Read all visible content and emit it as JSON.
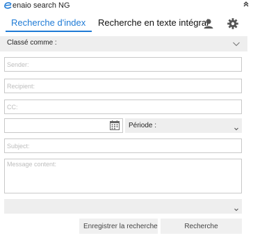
{
  "window": {
    "title": "enaio search NG",
    "logo_icon": "enaio-logo-icon",
    "collapse_icon": "double-chevron-up-icon"
  },
  "tabs": [
    {
      "label": "Recherche d'index",
      "active": true
    },
    {
      "label": "Recherche en texte intégral",
      "active": false
    }
  ],
  "toolbar_icons": [
    "user-icon",
    "gear-icon"
  ],
  "accent_color": "#1f7bd6",
  "classe": {
    "label": "Classé comme :",
    "icon": "chevron-down-icon"
  },
  "fields": {
    "sender": {
      "placeholder": "Sender:",
      "value": ""
    },
    "recipient": {
      "placeholder": "Recipient:",
      "value": ""
    },
    "cc": {
      "placeholder": "CC:",
      "value": ""
    },
    "date": {
      "placeholder": "",
      "value": "",
      "icon": "calendar-icon"
    },
    "subject": {
      "placeholder": "Subject:",
      "value": ""
    },
    "message": {
      "placeholder": "Message content:",
      "value": ""
    }
  },
  "periode": {
    "label": "Période :",
    "icon": "chevron-down-icon"
  },
  "bottom_select": {
    "value": "",
    "icon": "chevron-down-icon"
  },
  "buttons": {
    "save": "Enregistrer la recherche",
    "search": "Recherche"
  }
}
